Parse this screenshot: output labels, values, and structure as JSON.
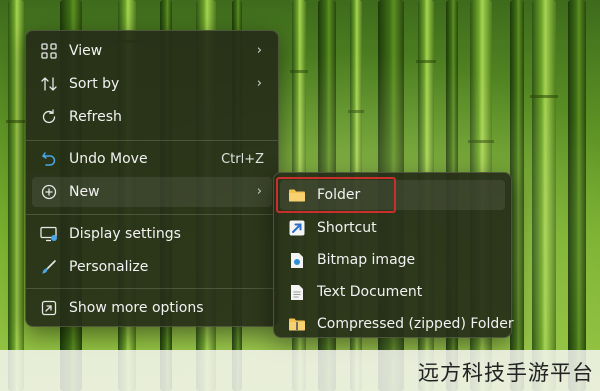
{
  "context_menu": {
    "items": [
      {
        "label": "View",
        "icon": "grid-icon",
        "has_submenu": true
      },
      {
        "label": "Sort by",
        "icon": "sort-icon",
        "has_submenu": true
      },
      {
        "label": "Refresh",
        "icon": "refresh-icon",
        "has_submenu": false
      },
      {
        "label": "Undo Move",
        "icon": "undo-icon",
        "shortcut": "Ctrl+Z"
      },
      {
        "label": "New",
        "icon": "plus-circle-icon",
        "has_submenu": true
      },
      {
        "label": "Display settings",
        "icon": "display-icon"
      },
      {
        "label": "Personalize",
        "icon": "brush-icon"
      },
      {
        "label": "Show more options",
        "icon": "more-options-icon"
      }
    ]
  },
  "new_submenu": {
    "items": [
      {
        "label": "Folder",
        "icon": "folder-icon",
        "highlighted": true
      },
      {
        "label": "Shortcut",
        "icon": "shortcut-icon"
      },
      {
        "label": "Bitmap image",
        "icon": "bitmap-icon"
      },
      {
        "label": "Text Document",
        "icon": "text-document-icon"
      },
      {
        "label": "Compressed (zipped) Folder",
        "icon": "zip-folder-icon"
      }
    ]
  },
  "colors": {
    "menu_bg": "#262d18",
    "highlight_border": "#c9302c",
    "folder_yellow": "#f2c14e",
    "accent_blue": "#4aa8e8"
  },
  "watermark": "远方科技手游平台"
}
